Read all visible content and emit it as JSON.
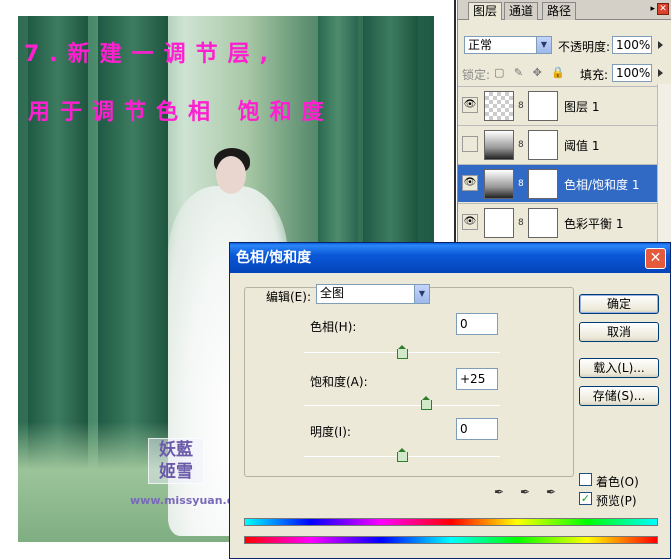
{
  "canvas": {
    "caption_line1": "7.新建一调节层,",
    "caption_line2": "用于调节色相 饱和度",
    "stamp_line1": "妖藍",
    "stamp_line2": "姬雪",
    "site": "www.missyuan.com"
  },
  "layers_panel": {
    "tabs": [
      "图层",
      "通道",
      "路径"
    ],
    "blend_mode": "正常",
    "opacity_label": "不透明度:",
    "opacity_value": "100%",
    "lock_label": "锁定:",
    "fill_label": "填充:",
    "fill_value": "100%",
    "layers": [
      {
        "name": "图层 1",
        "visible": true,
        "selected": false
      },
      {
        "name": "阈值 1",
        "visible": false,
        "selected": false
      },
      {
        "name": "色相/饱和度 1",
        "visible": true,
        "selected": true
      },
      {
        "name": "色彩平衡 1",
        "visible": true,
        "selected": false
      }
    ]
  },
  "dialog": {
    "title": "色相/饱和度",
    "edit_label": "编辑(E):",
    "edit_value": "全图",
    "hue_label": "色相(H):",
    "hue_value": "0",
    "saturation_label": "饱和度(A):",
    "saturation_value": "+25",
    "lightness_label": "明度(I):",
    "lightness_value": "0",
    "ok_label": "确定",
    "cancel_label": "取消",
    "load_label": "载入(L)...",
    "save_label": "存储(S)...",
    "colorize_label": "着色(O)",
    "colorize_checked": false,
    "preview_label": "预览(P)",
    "preview_checked": true
  }
}
